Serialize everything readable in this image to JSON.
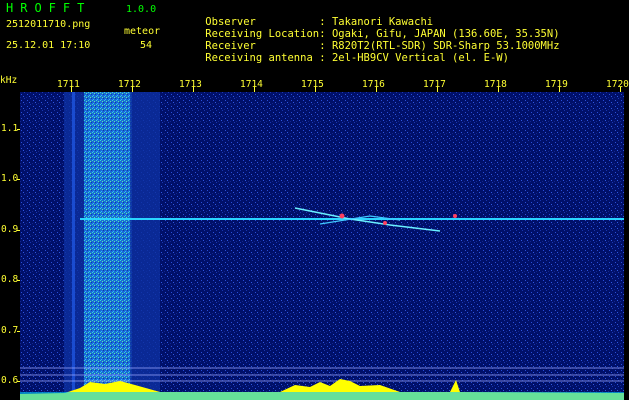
{
  "header": {
    "app_name": "HROFFT",
    "app_version": "1.0.0",
    "filename": "2512011710.png",
    "timestamp": "25.12.01 17:10",
    "meteor_label": "meteor",
    "meteor_count": "54",
    "info": [
      {
        "key": "Observer",
        "value": ": Takanori Kawachi"
      },
      {
        "key": "Receiving Location",
        "value": ": Ogaki, Gifu, JAPAN (136.60E, 35.35N)"
      },
      {
        "key": "Receiver",
        "value": ": R820T2(RTL-SDR) SDR-Sharp 53.1000MHz"
      },
      {
        "key": "Receiving antenna",
        "value": ": 2el-HB9CV Vertical (el. E-W)"
      }
    ]
  },
  "spectrogram": {
    "unit": "kHz",
    "time_ticks": [
      "1711",
      "1712",
      "1713",
      "1714",
      "1715",
      "1716",
      "1717",
      "1718",
      "1719",
      "1720"
    ],
    "freq_ticks": [
      "1.1",
      "1.0",
      "0.9",
      "0.8",
      "0.7",
      "0.6"
    ],
    "colors": {
      "label": "#ffff33",
      "title": "#00ff00",
      "background": "#00116b",
      "carrier": "#2ad4ff"
    }
  }
}
